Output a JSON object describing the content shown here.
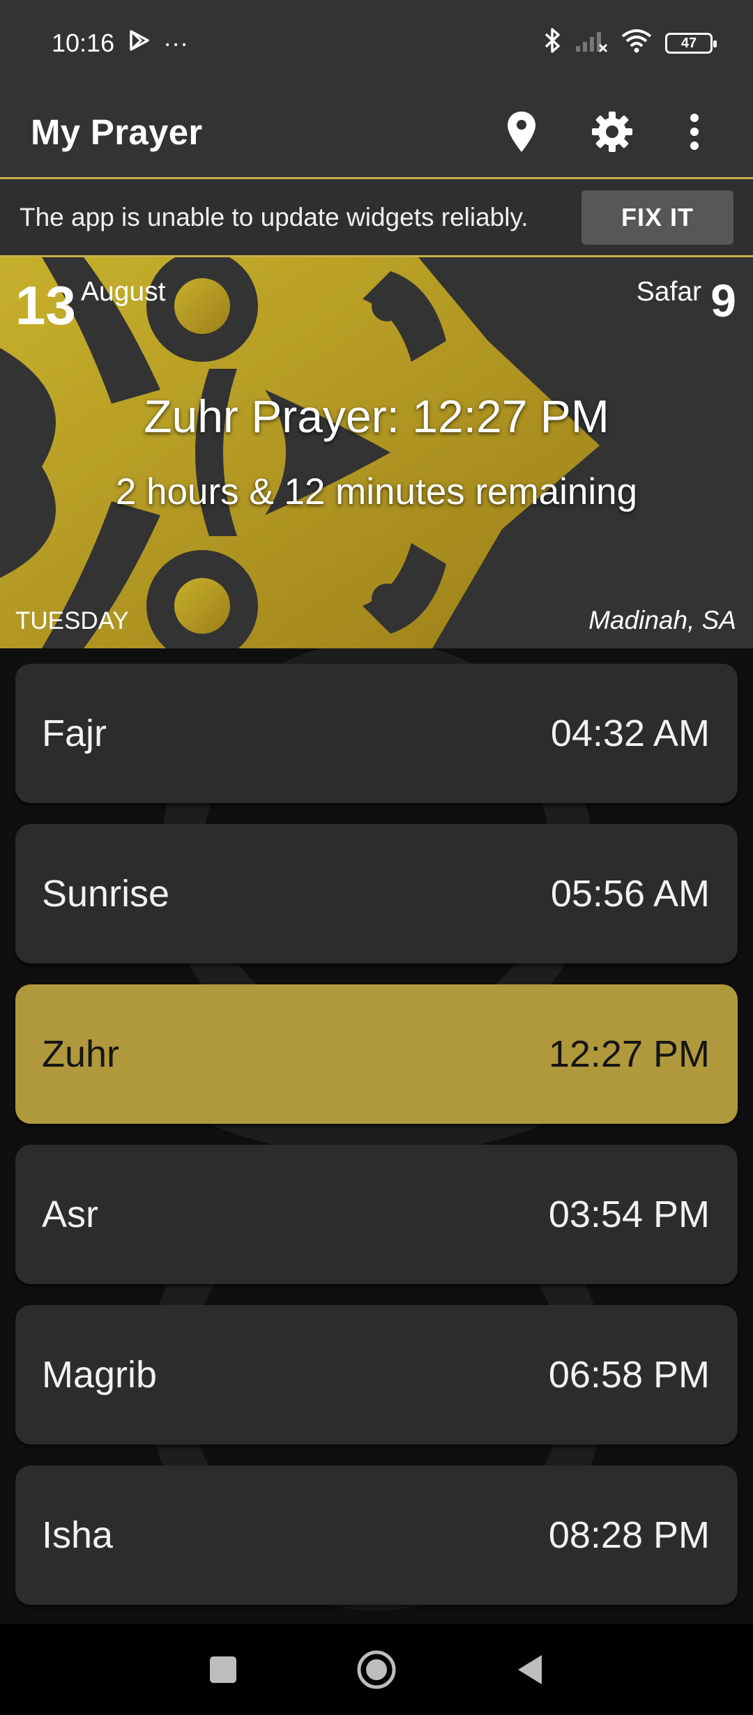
{
  "status_bar": {
    "time": "10:16",
    "ellipsis": "···",
    "battery": "47"
  },
  "app_bar": {
    "title": "My Prayer",
    "icons": [
      "location-pin-icon",
      "gear-icon",
      "more-vert-icon"
    ]
  },
  "banner": {
    "message": "The app is unable to update widgets reliably.",
    "fix_label": "FIX IT"
  },
  "header": {
    "day": "13",
    "month": "August",
    "hijri_month": "Safar",
    "hijri_day": "9",
    "next_prayer": "Zuhr Prayer: 12:27 PM",
    "remaining": "2 hours & 12 minutes remaining",
    "weekday": "TUESDAY",
    "location": "Madinah, SA"
  },
  "prayers": [
    {
      "name": "Fajr",
      "time": "04:32 AM"
    },
    {
      "name": "Sunrise",
      "time": "05:56 AM"
    },
    {
      "name": "Zuhr",
      "time": "12:27 PM",
      "active": true
    },
    {
      "name": "Asr",
      "time": "03:54 PM"
    },
    {
      "name": "Magrib",
      "time": "06:58 PM"
    },
    {
      "name": "Isha",
      "time": "08:28 PM"
    }
  ],
  "colors": {
    "accent_gold": "#b0993c",
    "bar_background": "#333333",
    "card_background": "#2c2c2c"
  }
}
